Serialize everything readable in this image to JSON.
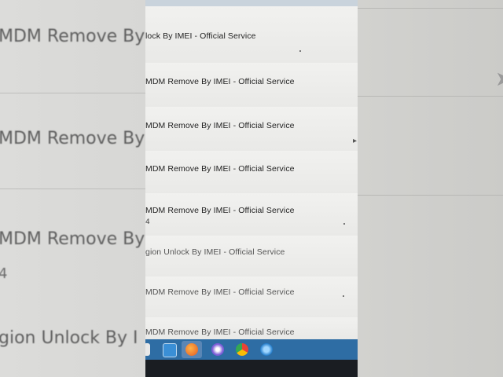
{
  "background_left": {
    "texts": [
      "MDM Remove By",
      "MDM Remove By",
      "MDM Remove By",
      "gion Unlock By I"
    ],
    "numbers": [
      "4"
    ]
  },
  "rows": [
    {
      "title": "lock By IMEI - Official Service",
      "sub": ""
    },
    {
      "title": "MDM Remove By IMEI - Official Service",
      "sub": ""
    },
    {
      "title": "MDM Remove By IMEI - Official Service",
      "sub": ""
    },
    {
      "title": "MDM Remove By IMEI - Official Service",
      "sub": ""
    },
    {
      "title": "MDM Remove By IMEI - Official Service",
      "sub": "4"
    },
    {
      "title": "gion Unlock By IMEI - Official Service",
      "sub": ""
    },
    {
      "title": "MDM Remove By IMEI - Official Service",
      "sub": ""
    },
    {
      "title": "MDM Remove By IMEI - Official Service",
      "sub": ""
    }
  ],
  "taskbar": {
    "icons": [
      "file-explorer-icon",
      "mail-icon",
      "firefox-icon",
      "app-icon",
      "chrome-icon",
      "edge-icon"
    ]
  },
  "colors": {
    "taskbar": "#2e6da4",
    "row_background": "#f1f1ef"
  }
}
